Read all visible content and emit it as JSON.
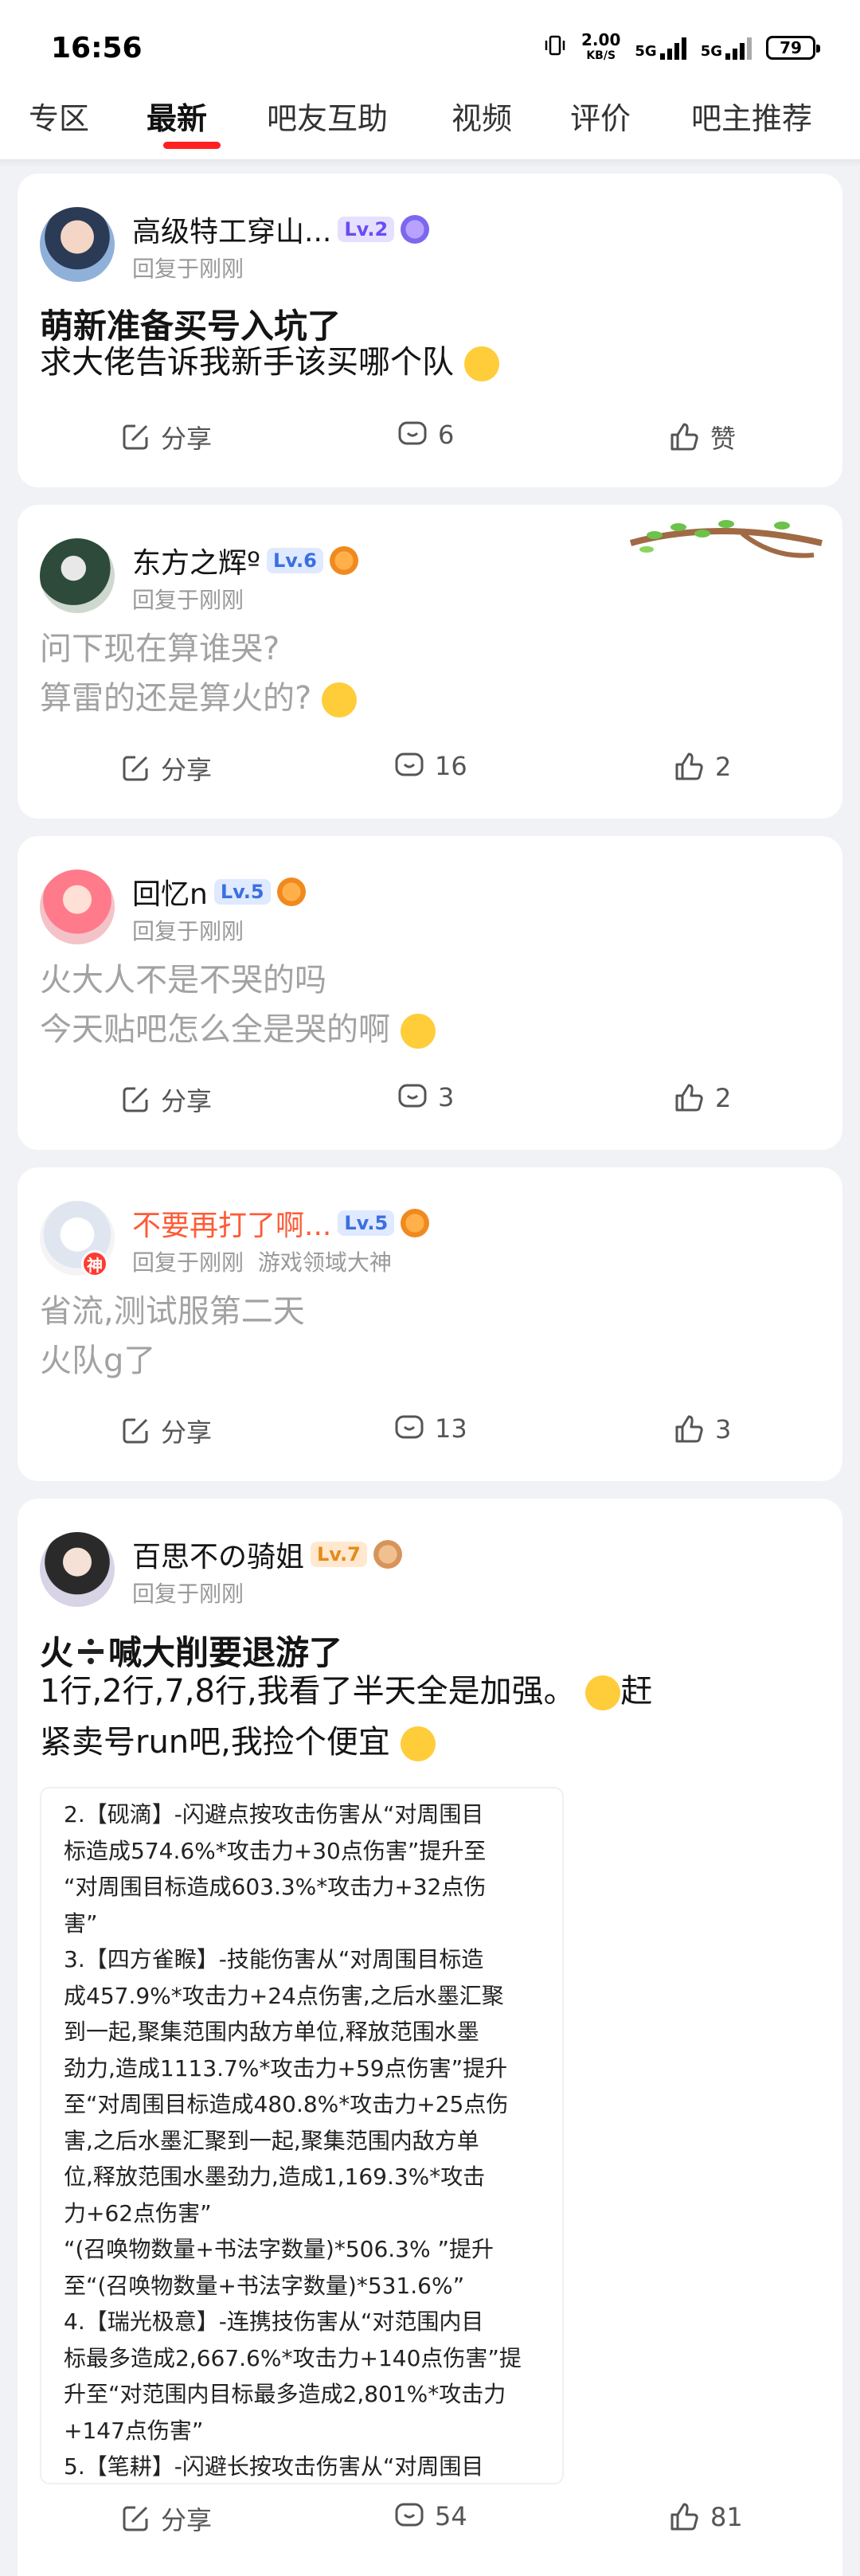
{
  "status_bar": {
    "time": "16:56",
    "net_speed": "2.00",
    "net_unit": "KB/S",
    "net1": "5G",
    "net2": "5G",
    "battery": "79"
  },
  "tabs": [
    {
      "label": "专区"
    },
    {
      "label": "最新"
    },
    {
      "label": "吧友互助"
    },
    {
      "label": "视频"
    },
    {
      "label": "评价"
    },
    {
      "label": "吧主推荐"
    }
  ],
  "accent_color": "#ff2121",
  "posts": [
    {
      "username": "高级特工穿山...",
      "level": "Lv.2",
      "meta": "回复于刚刚",
      "title": "萌新准备买号入坑了",
      "body": [
        "求大佬告诉我新手该买哪个队"
      ],
      "share": "分享",
      "comments": "6",
      "likes": "赞"
    },
    {
      "username": "东方之辉º",
      "level": "Lv.6",
      "meta": "回复于刚刚",
      "body": [
        "问下现在算谁哭?",
        "算雷的还是算火的?"
      ],
      "share": "分享",
      "comments": "16",
      "likes": "2"
    },
    {
      "username": "回忆n",
      "level": "Lv.5",
      "meta": "回复于刚刚",
      "body": [
        "火大人不是不哭的吗",
        "今天贴吧怎么全是哭的啊"
      ],
      "share": "分享",
      "comments": "3",
      "likes": "2"
    },
    {
      "username": "不要再打了啊...",
      "level": "Lv.5",
      "meta": "回复于刚刚",
      "meta_extra": "游戏领域大神",
      "avatar_badge": "神",
      "body": [
        "省流,测试服第二天",
        "火队g了"
      ],
      "share": "分享",
      "comments": "13",
      "likes": "3"
    },
    {
      "username": "百思不の骑姐",
      "level": "Lv.7",
      "meta": "回复于刚刚",
      "title_a": "火",
      "title_b": "喊大削要退游了",
      "body": [
        "1行,2行,7,8行,我看了半天全是加强。",
        "赶",
        "紧卖号run吧,我捡个便宜"
      ],
      "image_text": [
        "2.【砚滴】-闪避点按攻击伤害从“对周围目",
        "标造成574.6%*攻击力+30点伤害”提升至",
        "“对周围目标造成603.3%*攻击力+32点伤",
        "害”",
        "3.【四方雀睺】-技能伤害从“对周围目标造",
        "成457.9%*攻击力+24点伤害,之后水墨汇聚",
        "到一起,聚集范围内敌方单位,释放范围水墨",
        "劲力,造成1113.7%*攻击力+59点伤害”提升",
        "至“对周围目标造成480.8%*攻击力+25点伤",
        "害,之后水墨汇聚到一起,聚集范围内敌方单",
        "位,释放范围水墨劲力,造成1,169.3%*攻击",
        "力+62点伤害”",
        "“(召唤物数量+书法字数量)*506.3% ”提升",
        "至“(召唤物数量+书法字数量)*531.6%”",
        "4.【瑞光极意】-连携技伤害从“对范围内目",
        "标最多造成2,667.6%*攻击力+140点伤害”提",
        "升至“对范围内目标最多造成2,801%*攻击力",
        "+147点伤害”",
        "5.【笔耕】-闪避长按攻击伤害从“对周围目"
      ],
      "share": "分享",
      "comments": "54",
      "likes": "81"
    }
  ]
}
